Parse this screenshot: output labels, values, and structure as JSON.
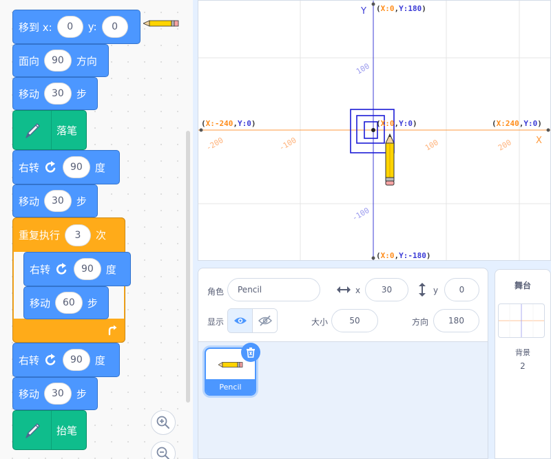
{
  "blocks": {
    "goto": {
      "label": "移到 x:",
      "x": "0",
      "y_label": "y:",
      "y": "0"
    },
    "point": {
      "label": "面向",
      "value": "90",
      "suffix": "方向"
    },
    "move1": {
      "label": "移动",
      "value": "30",
      "suffix": "步"
    },
    "pen_down": {
      "label": "落笔"
    },
    "turn1": {
      "label": "右转",
      "value": "90",
      "suffix": "度"
    },
    "move2": {
      "label": "移动",
      "value": "30",
      "suffix": "步"
    },
    "repeat": {
      "label": "重复执行",
      "value": "3",
      "suffix": "次"
    },
    "turn_inner": {
      "label": "右转",
      "value": "90",
      "suffix": "度"
    },
    "move_inner": {
      "label": "移动",
      "value": "60",
      "suffix": "步"
    },
    "turn2": {
      "label": "右转",
      "value": "90",
      "suffix": "度"
    },
    "move3": {
      "label": "移动",
      "value": "30",
      "suffix": "步"
    },
    "pen_up": {
      "label": "抬笔"
    }
  },
  "stage": {
    "axis_x_label": "X",
    "axis_y_label": "Y",
    "coord_top": [
      "(",
      "X:0",
      ",",
      "Y:180",
      ")"
    ],
    "coord_bottom": [
      "(",
      "X:0",
      ",",
      "Y:-180",
      ")"
    ],
    "coord_left": [
      "(",
      "X:-240",
      ",",
      "Y:0",
      ")"
    ],
    "coord_right": [
      "(",
      "X:240",
      ",",
      "Y:0",
      ")"
    ],
    "coord_center": [
      "(",
      "X:0",
      ",",
      "Y:0",
      ")"
    ],
    "tick_x_neg200": "-200",
    "tick_x_neg100": "-100",
    "tick_x_100": "100",
    "tick_x_200": "200",
    "tick_y_100": "100",
    "tick_y_neg100": "-100"
  },
  "sprite_info": {
    "sprite_label": "角色",
    "sprite_name": "Pencil",
    "x_label": "x",
    "x_value": "30",
    "y_label": "y",
    "y_value": "0",
    "show_label": "显示",
    "size_label": "大小",
    "size_value": "50",
    "direction_label": "方向",
    "direction_value": "180"
  },
  "sprites": [
    {
      "name": "Pencil"
    }
  ],
  "stage_panel": {
    "title": "舞台",
    "backdrops_label": "背景",
    "backdrops_count": "2"
  },
  "colors": {
    "motion": "#4c97ff",
    "control": "#ffab19",
    "pen": "#0fbd8c",
    "x_axis": "#ff9a3c",
    "y_axis": "#3b3bd6",
    "drawn_square": "#1a1ad6"
  }
}
